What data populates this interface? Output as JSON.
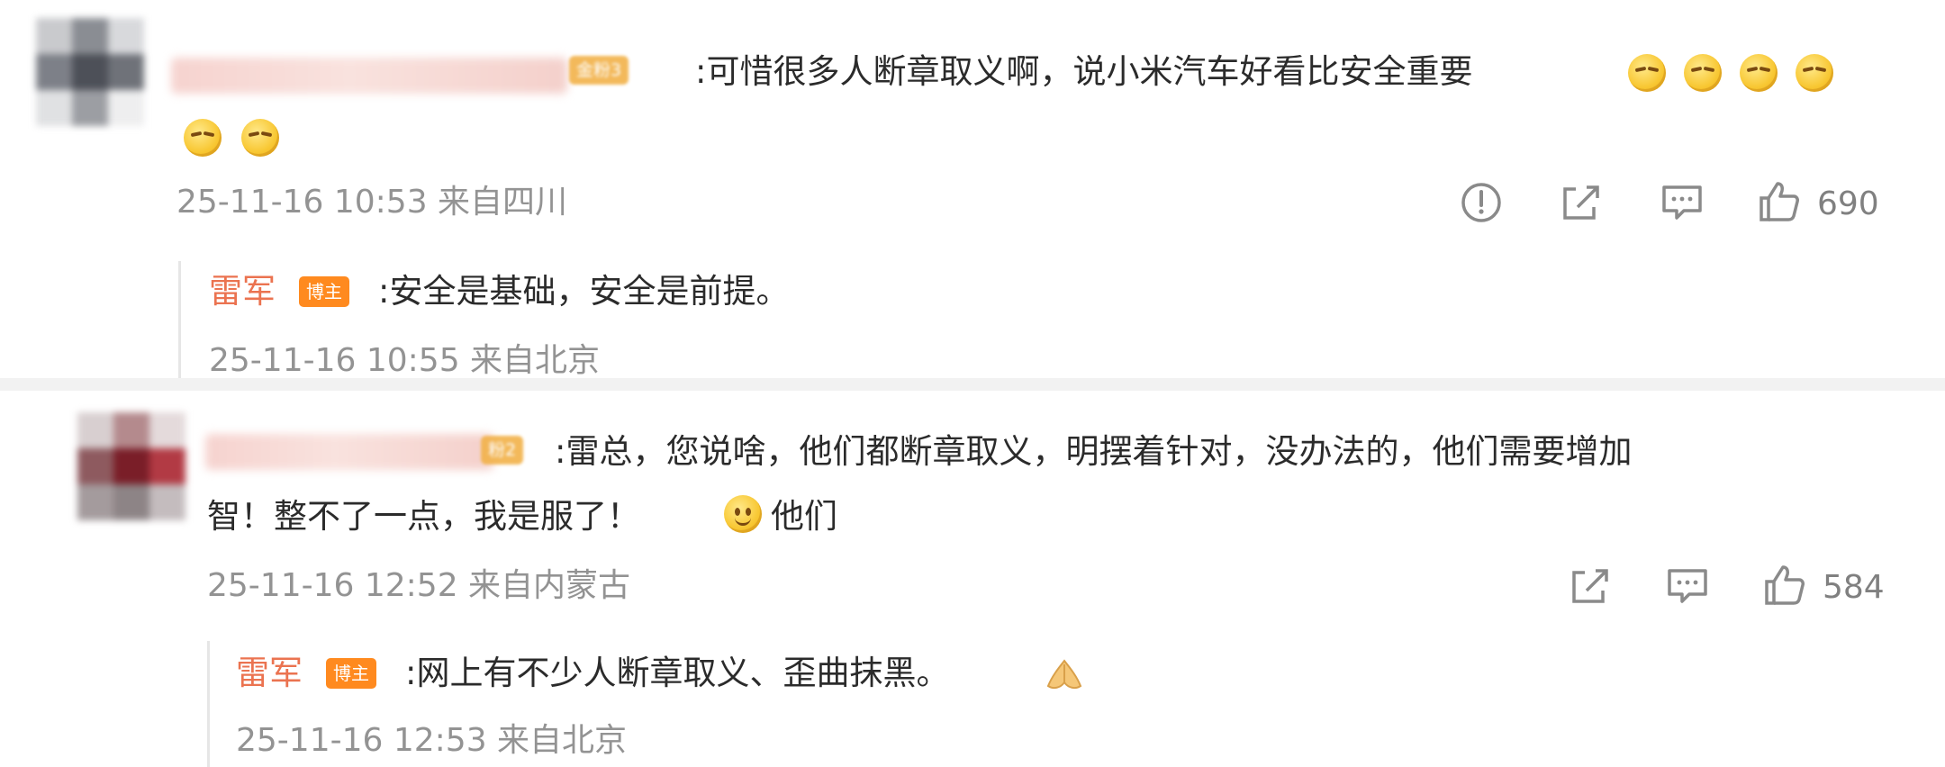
{
  "comments": [
    {
      "badge": "金粉3",
      "text": ":可惜很多人断章取义啊，说小米汽车好看比安全重要",
      "time": "25-11-16 10:53 来自四川",
      "likes": "690",
      "emoji_count": 6,
      "emoji_name": "sly-smile",
      "reply": {
        "author": "雷军",
        "badge": "博主",
        "text": ":安全是基础，安全是前提。",
        "time": "25-11-16 10:55 来自北京"
      }
    },
    {
      "badge": "粉2",
      "text_line1": ":雷总，您说啥，他们都断章取义，明摆着针对，没办法的，他们需要增加",
      "text_line2_a": "智！整不了一点，我是服了！",
      "text_line2_b": "他们",
      "time": "25-11-16 12:52 来自内蒙古",
      "likes": "584",
      "emoji_name": "smile",
      "reply": {
        "author": "雷军",
        "badge": "博主",
        "text": ":网上有不少人断章取义、歪曲抹黑。",
        "time": "25-11-16 12:53 来自北京",
        "emoji_name": "pray"
      }
    }
  ],
  "icons": {
    "report": "report-icon",
    "share": "share-icon",
    "comment": "comment-icon",
    "like": "like-icon"
  },
  "colors": {
    "author": "#eb7350",
    "host_badge": "#ff8a1f",
    "fan_badge": "#f2b24a",
    "meta": "#939393"
  }
}
